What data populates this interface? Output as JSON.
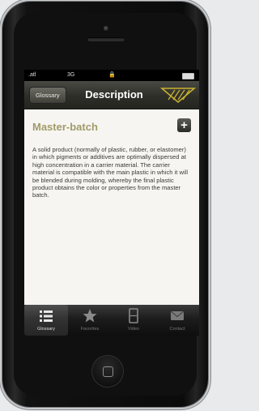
{
  "status": {
    "signal": ".atl",
    "carrier": "3G",
    "lock": "🔒"
  },
  "nav": {
    "back_label": "Glossary",
    "title": "Description"
  },
  "entry": {
    "title": "Master-batch",
    "add_label": "+",
    "description": "A solid product (normally of plastic, rubber, or elastomer) in which pigments or additives are optimally dispersed at high concentration in a carrier material. The carrier material is compatible with the main plastic in which it will be blended during molding, whereby the final plastic product obtains the color or properties from the master batch."
  },
  "tabs": [
    {
      "label": "Glossary",
      "icon": "list-icon",
      "active": true
    },
    {
      "label": "Favorites",
      "icon": "star-icon",
      "active": false
    },
    {
      "label": "Video",
      "icon": "film-icon",
      "active": false
    },
    {
      "label": "Contact",
      "icon": "mail-icon",
      "active": false
    }
  ],
  "colors": {
    "accent": "#a19b6a",
    "logo": "#c7b22f",
    "navbar": "#2e2e29"
  }
}
